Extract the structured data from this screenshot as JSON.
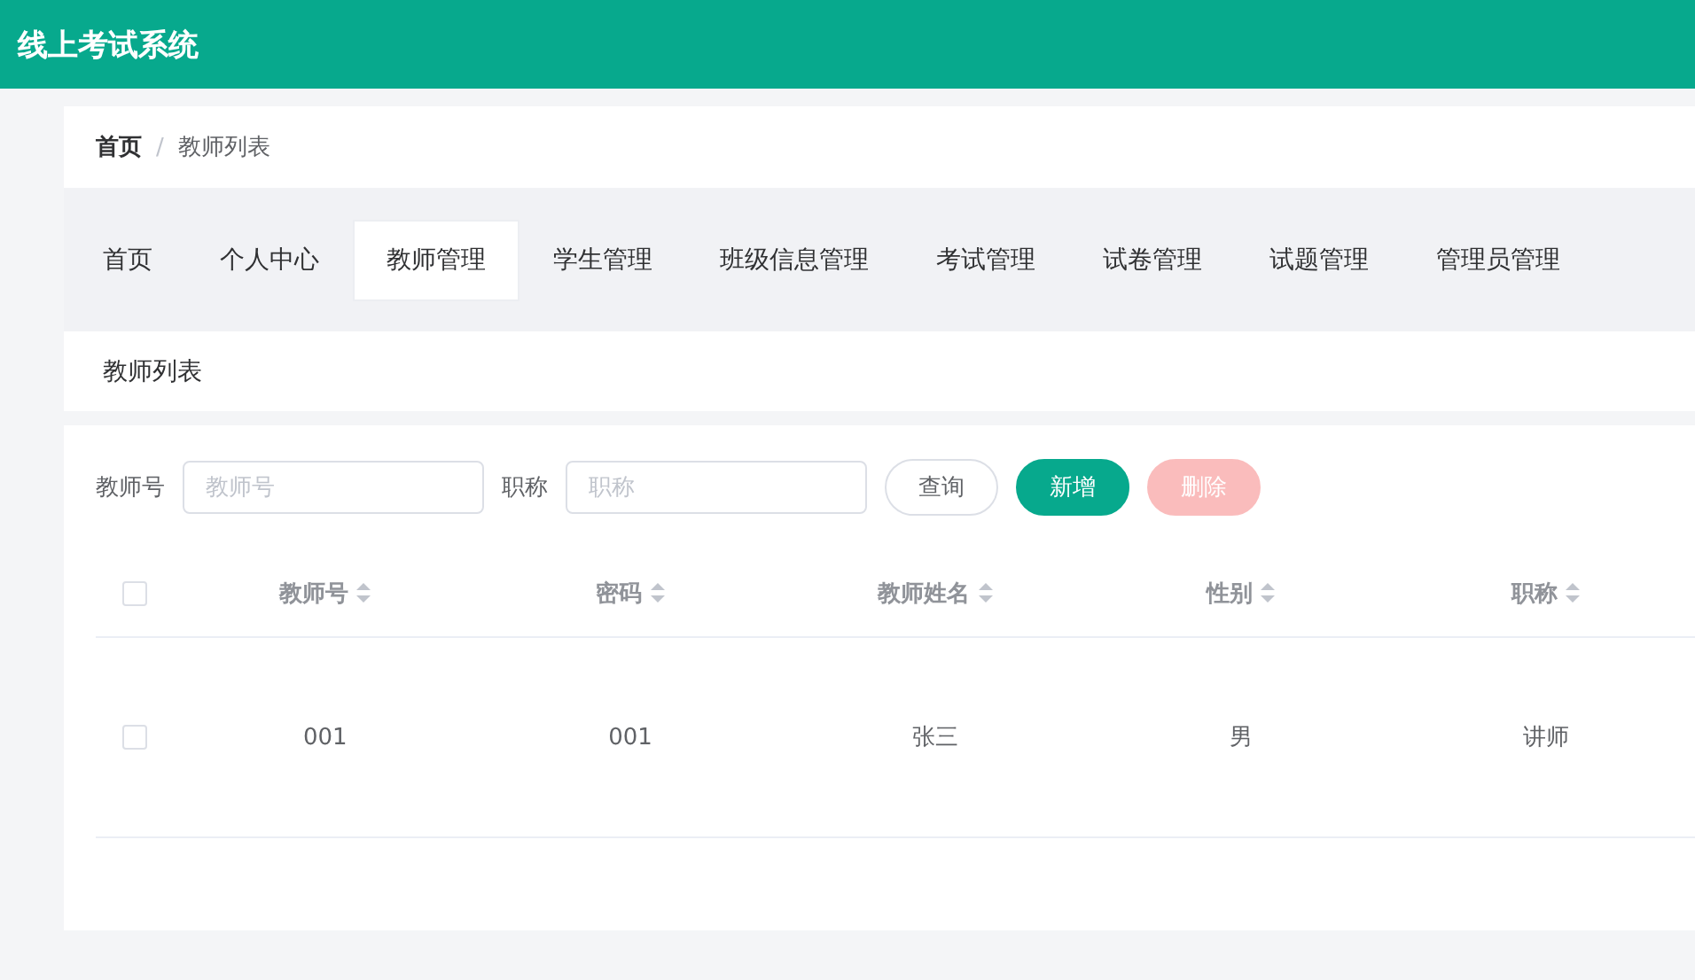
{
  "header": {
    "title": "线上考试系统"
  },
  "breadcrumb": [
    {
      "label": "首页",
      "current": false
    },
    {
      "label": "教师列表",
      "current": true
    }
  ],
  "breadcrumb_separator": "/",
  "nav_tabs": [
    {
      "label": "首页",
      "selected": false
    },
    {
      "label": "个人中心",
      "selected": false
    },
    {
      "label": "教师管理",
      "selected": true
    },
    {
      "label": "学生管理",
      "selected": false
    },
    {
      "label": "班级信息管理",
      "selected": false
    },
    {
      "label": "考试管理",
      "selected": false
    },
    {
      "label": "试卷管理",
      "selected": false
    },
    {
      "label": "试题管理",
      "selected": false
    },
    {
      "label": "管理员管理",
      "selected": false
    }
  ],
  "page_title": "教师列表",
  "filters": [
    {
      "label": "教师号",
      "placeholder": "教师号"
    },
    {
      "label": "职称",
      "placeholder": "职称"
    }
  ],
  "buttons": [
    {
      "label": "查询",
      "kind": "plain",
      "disabled": false
    },
    {
      "label": "新增",
      "kind": "primary",
      "disabled": false
    },
    {
      "label": "删除",
      "kind": "danger",
      "disabled": true
    }
  ],
  "table": {
    "select_all_checked": false,
    "columns": [
      {
        "label": "教师号",
        "sortable": true
      },
      {
        "label": "密码",
        "sortable": true
      },
      {
        "label": "教师姓名",
        "sortable": true
      },
      {
        "label": "性别",
        "sortable": true
      },
      {
        "label": "职称",
        "sortable": true
      }
    ],
    "rows": [
      {
        "checked": false,
        "cells": [
          "001",
          "001",
          "张三",
          "男",
          "讲师"
        ]
      }
    ]
  }
}
